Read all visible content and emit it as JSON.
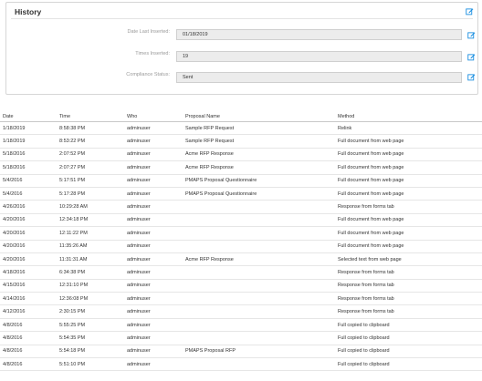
{
  "history": {
    "title": "History",
    "fields": [
      {
        "label": "Date Last Inserted:",
        "value": "01/18/2019"
      },
      {
        "label": "Times Inserted:",
        "value": "19"
      },
      {
        "label": "Compliance Status:",
        "value": "Sent"
      }
    ]
  },
  "table": {
    "columns": [
      "Date",
      "Time",
      "Who",
      "Proposal Name",
      "Method"
    ],
    "rows": [
      [
        "1/18/2019",
        "8:58:38 PM",
        "adminuser",
        "Sample RFP Request",
        "Relink"
      ],
      [
        "1/18/2019",
        "8:53:22 PM",
        "adminuser",
        "Sample RFP Request",
        "Full document from web page"
      ],
      [
        "5/18/2016",
        "2:07:52 PM",
        "adminuser",
        "Acme RFP Response",
        "Full document from web page"
      ],
      [
        "5/18/2016",
        "2:07:27 PM",
        "adminuser",
        "Acme RFP Response",
        "Full document from web page"
      ],
      [
        "5/4/2016",
        "5:17:51 PM",
        "adminuser",
        "PMAPS Proposal Questionnaire",
        "Full document from web page"
      ],
      [
        "5/4/2016",
        "5:17:28 PM",
        "adminuser",
        "PMAPS Proposal Questionnaire",
        "Full document from web page"
      ],
      [
        "4/26/2016",
        "10:29:28 AM",
        "adminuser",
        "",
        "Response from forms tab"
      ],
      [
        "4/20/2016",
        "12:34:18 PM",
        "adminuser",
        "",
        "Full document from web page"
      ],
      [
        "4/20/2016",
        "12:11:22 PM",
        "adminuser",
        "",
        "Full document from web page"
      ],
      [
        "4/20/2016",
        "11:35:26 AM",
        "adminuser",
        "",
        "Full document from web page"
      ],
      [
        "4/20/2016",
        "11:31:31 AM",
        "adminuser",
        "Acme RFP Response",
        "Selected text from web page"
      ],
      [
        "4/18/2016",
        "6:34:38 PM",
        "adminuser",
        "",
        "Response from forms tab"
      ],
      [
        "4/15/2016",
        "12:31:10 PM",
        "adminuser",
        "",
        "Response from forms tab"
      ],
      [
        "4/14/2016",
        "12:36:08 PM",
        "adminuser",
        "",
        "Response from forms tab"
      ],
      [
        "4/12/2016",
        "2:30:15 PM",
        "adminuser",
        "",
        "Response from forms tab"
      ],
      [
        "4/8/2016",
        "5:55:25 PM",
        "adminuser",
        "",
        "Full copied to clipboard"
      ],
      [
        "4/8/2016",
        "5:54:35 PM",
        "adminuser",
        "",
        "Full copied to clipboard"
      ],
      [
        "4/8/2016",
        "5:54:18 PM",
        "adminuser",
        "PMAPS Proposal RFP",
        "Full copied to clipboard"
      ],
      [
        "4/8/2016",
        "5:51:10 PM",
        "adminuser",
        "",
        "Full copied to clipboard"
      ]
    ]
  },
  "colors": {
    "accent": "#1a8fe0",
    "input_bg": "#ececec",
    "border": "#d6d6d6"
  },
  "icons": {
    "edit": "pencil-square-icon"
  }
}
